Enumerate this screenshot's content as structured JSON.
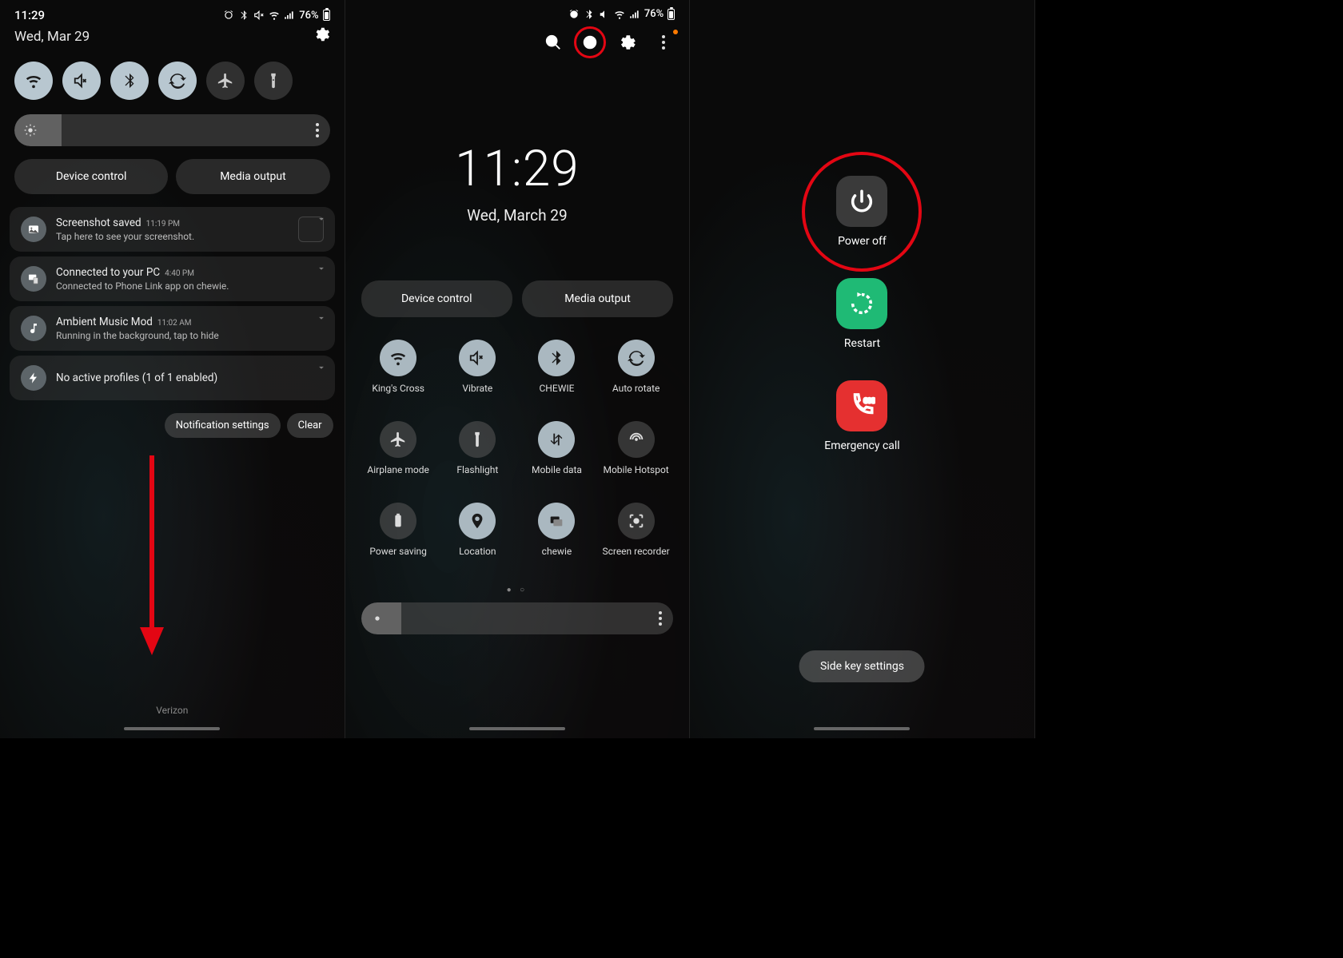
{
  "status": {
    "time": "11:29",
    "battery_pct": "76%",
    "icons": [
      "alarm",
      "bluetooth",
      "mute",
      "wifi",
      "signal"
    ]
  },
  "panel1": {
    "date": "Wed, Mar 29",
    "toggles": [
      {
        "id": "wifi",
        "on": true
      },
      {
        "id": "mute",
        "on": true
      },
      {
        "id": "bluetooth",
        "on": true
      },
      {
        "id": "autorotate",
        "on": true
      },
      {
        "id": "airplane",
        "on": false
      },
      {
        "id": "flashlight",
        "on": false
      }
    ],
    "device_control": "Device control",
    "media_output": "Media output",
    "notifications": [
      {
        "icon": "image",
        "title": "Screenshot saved",
        "ts": "11:19 PM",
        "sub": "Tap here to see your screenshot.",
        "thumb": true
      },
      {
        "icon": "pc",
        "title": "Connected to your PC",
        "ts": "4:40 PM",
        "sub": "Connected to Phone Link app on chewie."
      },
      {
        "icon": "music",
        "title": "Ambient Music Mod",
        "ts": "11:02 AM",
        "sub": "Running in the background, tap to hide"
      },
      {
        "icon": "bolt",
        "title": "No active profiles (1 of 1 enabled)",
        "ts": "",
        "sub": ""
      }
    ],
    "notif_settings": "Notification settings",
    "clear": "Clear",
    "carrier": "Verizon"
  },
  "panel2": {
    "clock_time": "11:29",
    "clock_date": "Wed, March 29",
    "device_control": "Device control",
    "media_output": "Media output",
    "tiles": [
      {
        "id": "wifi",
        "label": "King's Cross",
        "on": true
      },
      {
        "id": "vibrate",
        "label": "Vibrate",
        "on": true
      },
      {
        "id": "bluetooth",
        "label": "CHEWIE",
        "on": true
      },
      {
        "id": "autorotate",
        "label": "Auto rotate",
        "on": true
      },
      {
        "id": "airplane",
        "label": "Airplane mode",
        "on": false
      },
      {
        "id": "flashlight",
        "label": "Flashlight",
        "on": false
      },
      {
        "id": "mobiledata",
        "label": "Mobile data",
        "on": true
      },
      {
        "id": "hotspot",
        "label": "Mobile Hotspot",
        "on": false
      },
      {
        "id": "powersave",
        "label": "Power saving",
        "on": false
      },
      {
        "id": "location",
        "label": "Location",
        "on": true
      },
      {
        "id": "chewie",
        "label": "chewie",
        "on": true
      },
      {
        "id": "screenrec",
        "label": "Screen recorder",
        "on": false
      }
    ]
  },
  "panel3": {
    "power_off": "Power off",
    "restart": "Restart",
    "emergency": "Emergency call",
    "sos": "SOS",
    "side_key": "Side key settings"
  }
}
